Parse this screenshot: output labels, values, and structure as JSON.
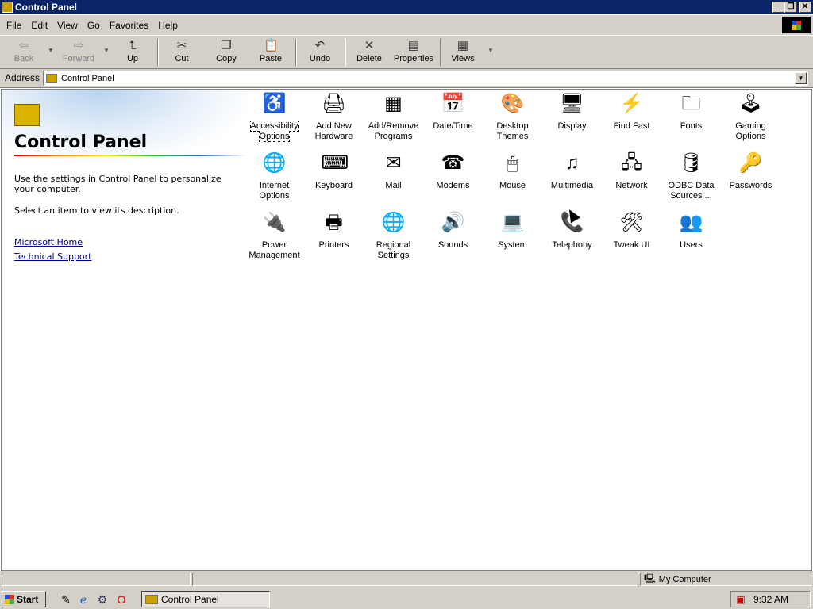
{
  "window": {
    "title": "Control Panel",
    "controls": {
      "minimize": "_",
      "restore": "❐",
      "close": "✕"
    }
  },
  "menu": [
    "File",
    "Edit",
    "View",
    "Go",
    "Favorites",
    "Help"
  ],
  "toolbar": {
    "back": "Back",
    "forward": "Forward",
    "up": "Up",
    "cut": "Cut",
    "copy": "Copy",
    "paste": "Paste",
    "undo": "Undo",
    "delete": "Delete",
    "properties": "Properties",
    "views": "Views"
  },
  "address": {
    "label": "Address",
    "value": "Control Panel"
  },
  "left_pane": {
    "title": "Control Panel",
    "description": "Use the settings in Control Panel to personalize your computer.",
    "hint": "Select an item to view its description.",
    "links": [
      "Microsoft Home",
      "Technical Support"
    ]
  },
  "icons": [
    {
      "label": "Accessibility Options",
      "icon": "accessibility-icon",
      "selected": true
    },
    {
      "label": "Add New Hardware",
      "icon": "hardware-icon"
    },
    {
      "label": "Add/Remove Programs",
      "icon": "programs-icon"
    },
    {
      "label": "Date/Time",
      "icon": "calendar-clock-icon"
    },
    {
      "label": "Desktop Themes",
      "icon": "themes-icon"
    },
    {
      "label": "Display",
      "icon": "monitor-icon"
    },
    {
      "label": "Find Fast",
      "icon": "binoculars-icon"
    },
    {
      "label": "Fonts",
      "icon": "fonts-folder-icon"
    },
    {
      "label": "Gaming Options",
      "icon": "joystick-icon"
    },
    {
      "label": "Internet Options",
      "icon": "globe-icon"
    },
    {
      "label": "Keyboard",
      "icon": "keyboard-icon"
    },
    {
      "label": "Mail",
      "icon": "mail-icon"
    },
    {
      "label": "Modems",
      "icon": "telephone-icon"
    },
    {
      "label": "Mouse",
      "icon": "mouse-icon"
    },
    {
      "label": "Multimedia",
      "icon": "multimedia-icon"
    },
    {
      "label": "Network",
      "icon": "network-icon"
    },
    {
      "label": "ODBC Data Sources ...",
      "icon": "database-icon"
    },
    {
      "label": "Passwords",
      "icon": "keys-icon"
    },
    {
      "label": "Power Management",
      "icon": "power-plug-icon"
    },
    {
      "label": "Printers",
      "icon": "printer-folder-icon"
    },
    {
      "label": "Regional Settings",
      "icon": "globe-icon"
    },
    {
      "label": "Sounds",
      "icon": "speaker-icon"
    },
    {
      "label": "System",
      "icon": "computer-icon"
    },
    {
      "label": "Telephony",
      "icon": "telephony-icon"
    },
    {
      "label": "Tweak UI",
      "icon": "tweakui-icon"
    },
    {
      "label": "Users",
      "icon": "users-icon"
    }
  ],
  "status": {
    "zone": "My Computer"
  },
  "taskbar": {
    "start": "Start",
    "task": "Control Panel",
    "time": "9:32 AM"
  },
  "colors": {
    "titlebar": "#0a246a",
    "face": "#d4d0c8",
    "link": "#00008b"
  }
}
